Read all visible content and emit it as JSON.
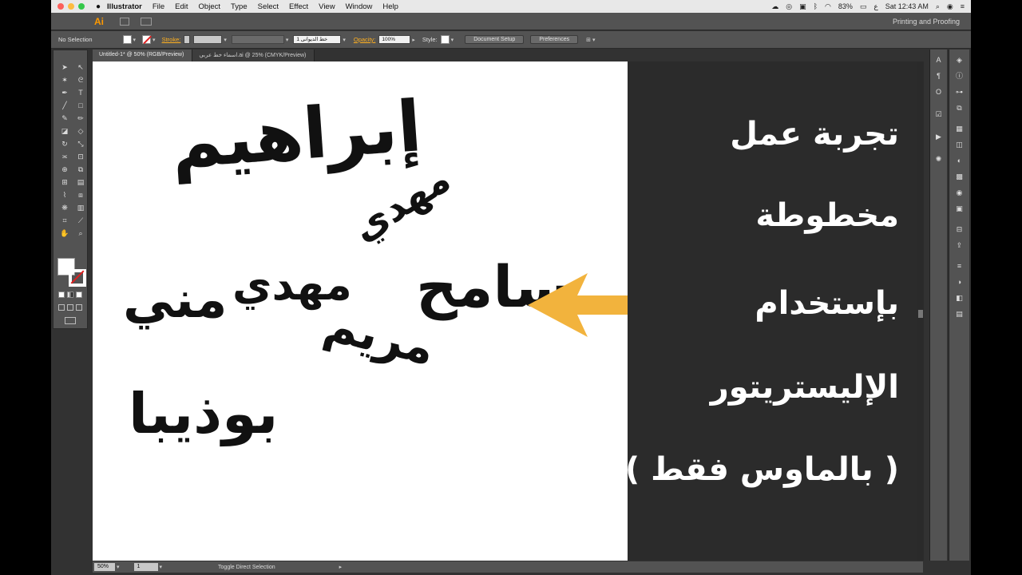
{
  "menubar": {
    "app_name": "Illustrator",
    "items": [
      "File",
      "Edit",
      "Object",
      "Type",
      "Select",
      "Effect",
      "View",
      "Window",
      "Help"
    ],
    "battery": "83%",
    "clock": "Sat 12:43 AM"
  },
  "appbar": {
    "logo": "Ai",
    "workspace": "Printing and Proofing"
  },
  "control": {
    "selection": "No Selection",
    "stroke_label": "Stroke:",
    "brush_value": "1 خط الديوانى",
    "opacity_label": "Opacity:",
    "opacity_value": "100%",
    "style_label": "Style:",
    "document_setup": "Document Setup",
    "preferences": "Preferences"
  },
  "tabs": [
    {
      "label": "Untitled-1* @ 50% (RGB/Preview)"
    },
    {
      "label": "اسماء خط عربي.ai @ 25% (CMYK/Preview)"
    }
  ],
  "artwork": {
    "names": [
      "إبراهيم",
      "مهدي",
      "سامح",
      "مهدي",
      "مني",
      "مريم",
      "بوذيبا"
    ]
  },
  "overlay_text": {
    "lines": [
      "تجربة عمل",
      "مخطوطة",
      "بإستخدام",
      "الإليستريتور",
      "( بالماوس فقط )"
    ],
    "arrow_color": "#f2b33d"
  },
  "statusbar": {
    "zoom": "50%",
    "page": "1",
    "message": "Toggle Direct Selection"
  },
  "colors": {
    "accent_orange": "#ff9a00",
    "panel_gray": "#535353"
  }
}
